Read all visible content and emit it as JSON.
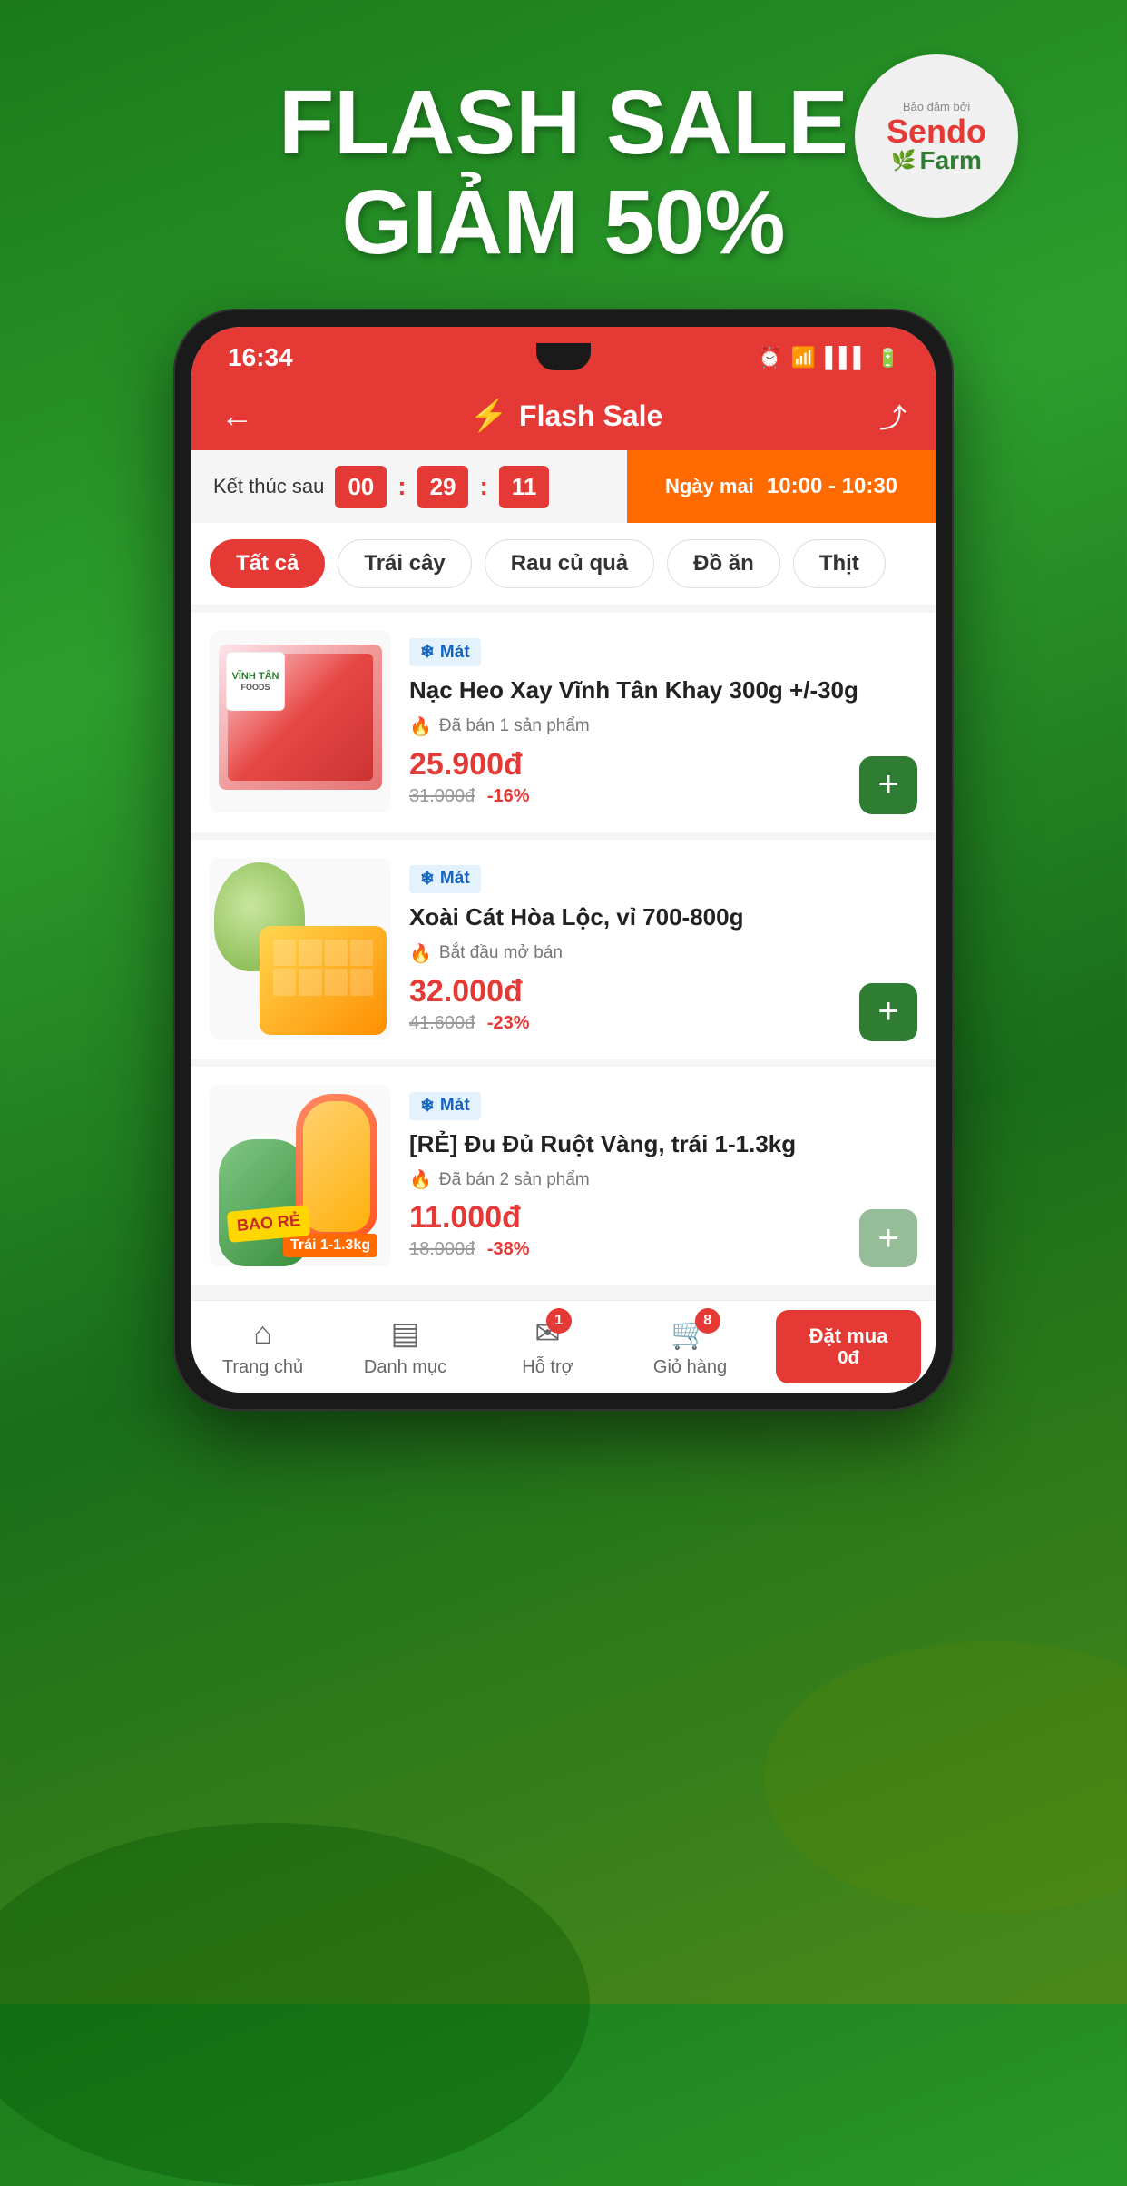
{
  "background": {
    "gradient_desc": "dark green radial gradient"
  },
  "hero": {
    "line1": "FLASH SALE",
    "line2": "GIẢM 50%"
  },
  "sendo_logo": {
    "supported_by": "Bảo đảm bởi",
    "brand": "Sendo",
    "sub": "Farm"
  },
  "status_bar": {
    "time": "16:34",
    "icons": [
      "alarm",
      "wifi",
      "signal",
      "battery"
    ]
  },
  "header": {
    "back_label": "←",
    "lightning": "⚡",
    "title": "Flash Sale",
    "share_label": "⤴"
  },
  "timer": {
    "label": "Kết thúc sau",
    "hours": "00",
    "minutes": "29",
    "seconds": "11",
    "next_label": "Ngày mai",
    "next_time": "10:00 - 10:30"
  },
  "categories": [
    {
      "id": "all",
      "label": "Tất cả",
      "active": true
    },
    {
      "id": "fruit",
      "label": "Trái cây",
      "active": false
    },
    {
      "id": "veggie",
      "label": "Rau củ quả",
      "active": false
    },
    {
      "id": "food",
      "label": "Đồ ăn",
      "active": false
    },
    {
      "id": "meat",
      "label": "Thịt",
      "active": false
    }
  ],
  "products": [
    {
      "id": "p1",
      "badge": "Mát",
      "name": "Nạc Heo Xay Vĩnh Tân Khay 300g +/-30g",
      "sold_text": "Đã bán 1 sản phẩm",
      "price": "25.900đ",
      "original_price": "31.000đ",
      "discount": "-16%",
      "image_type": "meat"
    },
    {
      "id": "p2",
      "badge": "Mát",
      "name": "Xoài Cát Hòa Lộc,  vỉ 700-800g",
      "sold_text": "Bắt đầu mở bán",
      "price": "32.000đ",
      "original_price": "41.600đ",
      "discount": "-23%",
      "image_type": "mango"
    },
    {
      "id": "p3",
      "badge": "Mát",
      "name": "[RẺ] Đu Đủ Ruột Vàng, trái 1-1.3kg",
      "sold_text": "Đã bán 2 sản phẩm",
      "price": "11.000đ",
      "original_price": "18.000đ",
      "discount": "-38%",
      "image_type": "papaya",
      "badge_bao_re": "BAO RẺ",
      "badge_trai": "Trái 1-1.3kg"
    }
  ],
  "bottom_nav": [
    {
      "id": "home",
      "icon": "⌂",
      "label": "Trang chủ",
      "badge": null
    },
    {
      "id": "category",
      "icon": "▤",
      "label": "Danh mục",
      "badge": null
    },
    {
      "id": "support",
      "icon": "✉",
      "label": "Hỗ trợ",
      "badge": "1"
    },
    {
      "id": "cart",
      "icon": "🛒",
      "label": "Giỏ hàng",
      "badge": "8"
    }
  ],
  "order_button": {
    "label": "Đặt mua",
    "price": "0đ"
  },
  "buttons": {
    "add": "+"
  }
}
